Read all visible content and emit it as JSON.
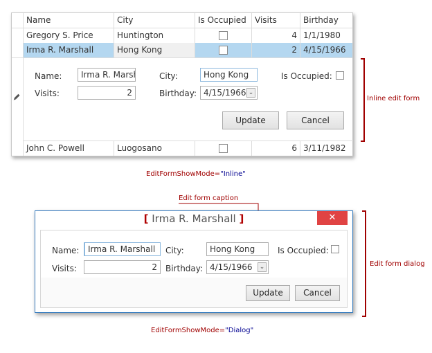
{
  "grid": {
    "columns": [
      "Name",
      "City",
      "Is Occupied",
      "Visits",
      "Birthday"
    ],
    "rows": [
      {
        "name": "Gregory S. Price",
        "city": "Huntington",
        "occupied": false,
        "visits": "4",
        "birthday": "1/1/1980"
      },
      {
        "name": "Irma R. Marshall",
        "city": "Hong Kong",
        "occupied": false,
        "visits": "2",
        "birthday": "4/15/1966",
        "selected": true
      },
      {
        "name": "John C. Powell",
        "city": "Luogosano",
        "occupied": false,
        "visits": "6",
        "birthday": "3/11/1982"
      }
    ],
    "edit_indicator_icon": "pencil-icon"
  },
  "inline_form": {
    "name_label": "Name:",
    "name_value": "Irma R. Marsha",
    "city_label": "City:",
    "city_value": "Hong Kong",
    "occupied_label": "Is Occupied:",
    "visits_label": "Visits:",
    "visits_value": "2",
    "birthday_label": "Birthday:",
    "birthday_value": "4/15/1966",
    "update_label": "Update",
    "cancel_label": "Cancel"
  },
  "dialog": {
    "caption": "Irma R. Marshall",
    "close_icon": "close-icon",
    "name_label": "Name:",
    "name_value": "Irma R. Marshall",
    "city_label": "City:",
    "city_value": "Hong Kong",
    "occupied_label": "Is Occupied:",
    "visits_label": "Visits:",
    "visits_value": "2",
    "birthday_label": "Birthday:",
    "birthday_value": "4/15/1966",
    "update_label": "Update",
    "cancel_label": "Cancel"
  },
  "annotations": {
    "inline_edit_form": "Inline edit form",
    "inline_mode_prop": "EditFormShowMode=",
    "inline_mode_val": "\"Inline\"",
    "edit_form_caption": "Edit form caption",
    "edit_form_dialog": "Edit form dialog",
    "dialog_mode_prop": "EditFormShowMode=",
    "dialog_mode_val": "\"Dialog\""
  },
  "colors": {
    "selection": "#b4d7f0",
    "annotation": "#a00000",
    "annotation_value": "#000090",
    "close_button": "#e04343",
    "dialog_border": "#3c7fc0"
  }
}
